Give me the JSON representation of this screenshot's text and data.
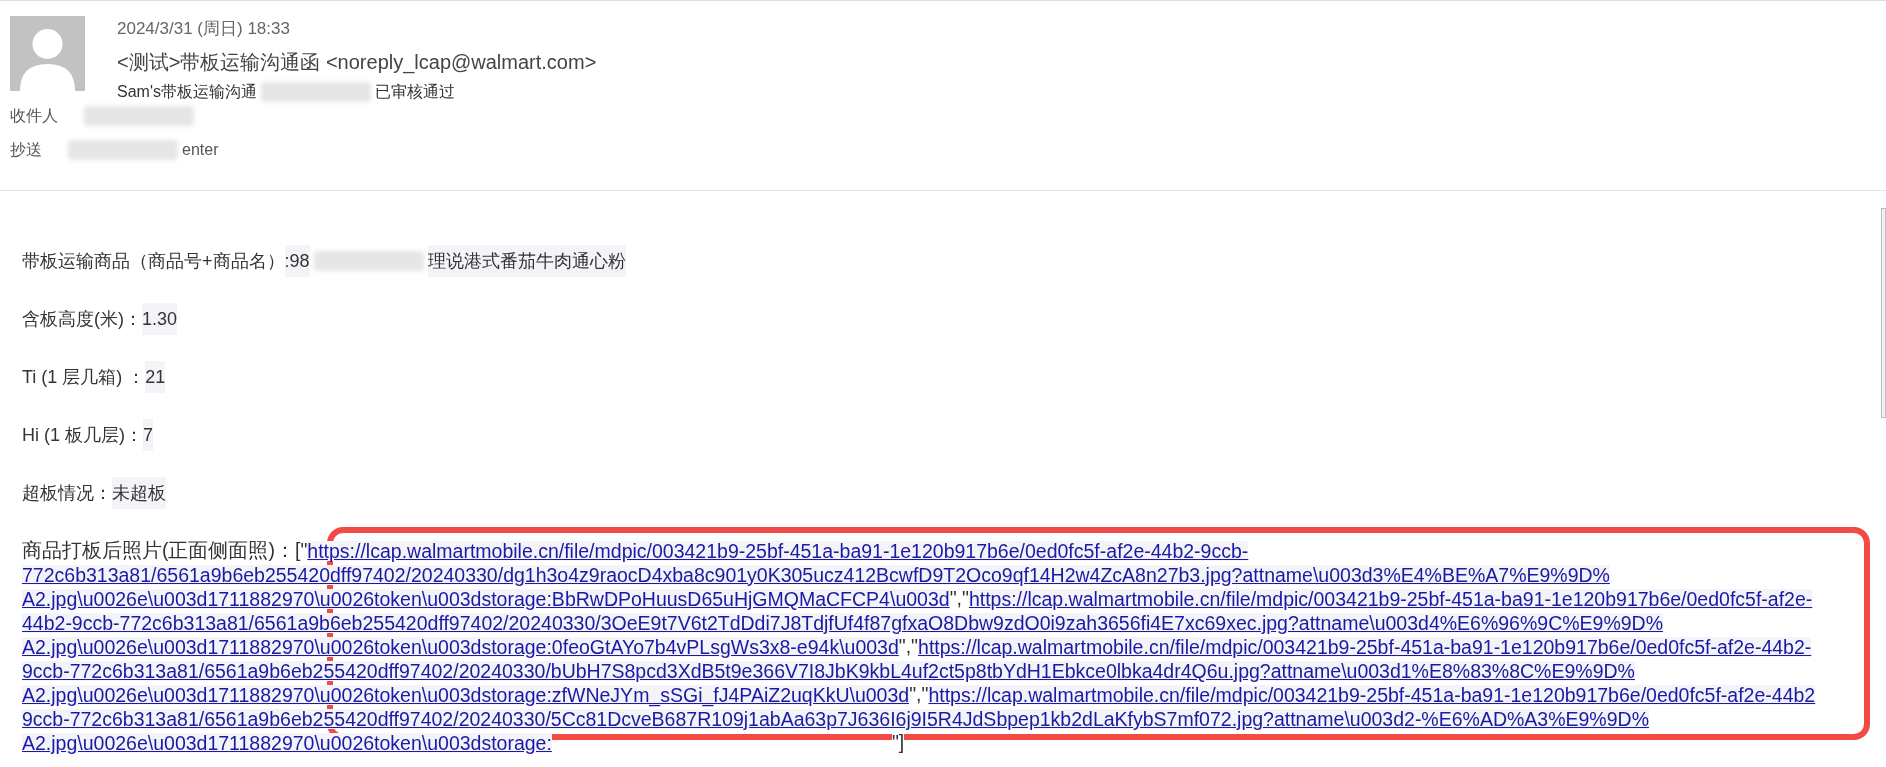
{
  "header": {
    "date": "2024/3/31 (周日) 18:33",
    "sender": "<测试>带板运输沟通函 <noreply_lcap@walmart.com>",
    "subject": [
      {
        "kind": "text",
        "text": "Sam's带板运输沟通"
      },
      {
        "kind": "redacted"
      },
      {
        "kind": "text",
        "text": "已审核通过"
      }
    ],
    "recipients": [
      {
        "label": "收件人",
        "parts": [
          {
            "kind": "redacted"
          }
        ]
      },
      {
        "label": "抄送",
        "parts": [
          {
            "kind": "redacted"
          },
          {
            "kind": "text",
            "text": "enter"
          }
        ]
      }
    ]
  },
  "fields": [
    {
      "label": "带板运输商品（商品号+商品名）",
      "parts": [
        {
          "kind": "text",
          "text": ":98"
        },
        {
          "kind": "redacted"
        },
        {
          "kind": "text",
          "text": "理说港式番茄牛肉通心粉"
        }
      ]
    },
    {
      "label": "含板高度(米)：",
      "parts": [
        {
          "kind": "text",
          "text": "1.30"
        }
      ]
    },
    {
      "label": "Ti (1 层几箱) ：",
      "parts": [
        {
          "kind": "text",
          "text": "21"
        }
      ]
    },
    {
      "label": "Hi (1 板几层)：",
      "parts": [
        {
          "kind": "text",
          "text": "7"
        }
      ]
    },
    {
      "label": "超板情况：",
      "parts": [
        {
          "kind": "text",
          "text": "未超板"
        }
      ]
    }
  ],
  "photos": {
    "lines": [
      [
        {
          "kind": "label",
          "text": "商品打板后照片(正面侧面照)："
        },
        {
          "kind": "text",
          "text": "[\""
        },
        {
          "kind": "link",
          "text": "https://lcap.walmartmobile.cn/file/mdpic/003421b9-25bf-451a-ba91-1e120b917b6e/0ed0fc5f-af2e-44b2-9ccb-"
        }
      ],
      [
        {
          "kind": "link",
          "text": "772c6b313a81/6561a9b6eb255420dff97402/20240330/dg1h3o4z9raocD4xba8c901y0K305ucz412BcwfD9T2Oco9qf14H2w4ZcA8n27b3.jpg?attname\\u003d3%E4%BE%A7%E9%9D%"
        }
      ],
      [
        {
          "kind": "link",
          "text": "A2.jpg\\u0026e\\u003d1711882970\\u0026token\\u003dstorage:BbRwDPoHuusD65uHjGMQMaCFCP4\\u003d"
        },
        {
          "kind": "text",
          "text": "\",\""
        },
        {
          "kind": "link",
          "text": "https://lcap.walmartmobile.cn/file/mdpic/003421b9-25bf-451a-ba91-1e120b917b6e/0ed0fc5f-af2e-"
        }
      ],
      [
        {
          "kind": "link",
          "text": "44b2-9ccb-772c6b313a81/6561a9b6eb255420dff97402/20240330/3OeE9t7V6t2TdDdi7J8TdjfUf4f87gfxaO8Dbw9zdO0i9zah3656fi4E7xc69xec.jpg?attname\\u003d4%E6%96%9C%E9%9D%"
        }
      ],
      [
        {
          "kind": "link",
          "text": "A2.jpg\\u0026e\\u003d1711882970\\u0026token\\u003dstorage:0feoGtAYo7b4vPLsgWs3x8-e94k\\u003d"
        },
        {
          "kind": "text",
          "text": "\",\""
        },
        {
          "kind": "link",
          "text": "https://lcap.walmartmobile.cn/file/mdpic/003421b9-25bf-451a-ba91-1e120b917b6e/0ed0fc5f-af2e-44b2-"
        }
      ],
      [
        {
          "kind": "link",
          "text": "9ccb-772c6b313a81/6561a9b6eb255420dff97402/20240330/bUbH7S8pcd3XdB5t9e366V7I8JbK9kbL4uf2ct5p8tbYdH1Ebkce0lbka4dr4Q6u.jpg?attname\\u003d1%E8%83%8C%E9%9D%"
        }
      ],
      [
        {
          "kind": "link",
          "text": "A2.jpg\\u0026e\\u003d1711882970\\u0026token\\u003dstorage:zfWNeJYm_sSGi_fJ4PAiZ2uqKkU\\u003d"
        },
        {
          "kind": "text",
          "text": "\",\""
        },
        {
          "kind": "link",
          "text": "https://lcap.walmartmobile.cn/file/mdpic/003421b9-25bf-451a-ba91-1e120b917b6e/0ed0fc5f-af2e-44b2"
        }
      ],
      [
        {
          "kind": "link",
          "text": "9ccb-772c6b313a81/6561a9b6eb255420dff97402/20240330/5Cc81DcveB687R109j1abAa63p7J636I6j9I5R4JdSbpep1kb2dLaKfybS7mf072.jpg?attname\\u003d2-%E6%AD%A3%E9%9D%"
        }
      ],
      [
        {
          "kind": "link",
          "text": "A2.jpg\\u0026e\\u003d1711882970\\u0026token\\u003dstorage:"
        },
        {
          "kind": "hidden"
        },
        {
          "kind": "text",
          "text": "\"]"
        }
      ]
    ]
  }
}
